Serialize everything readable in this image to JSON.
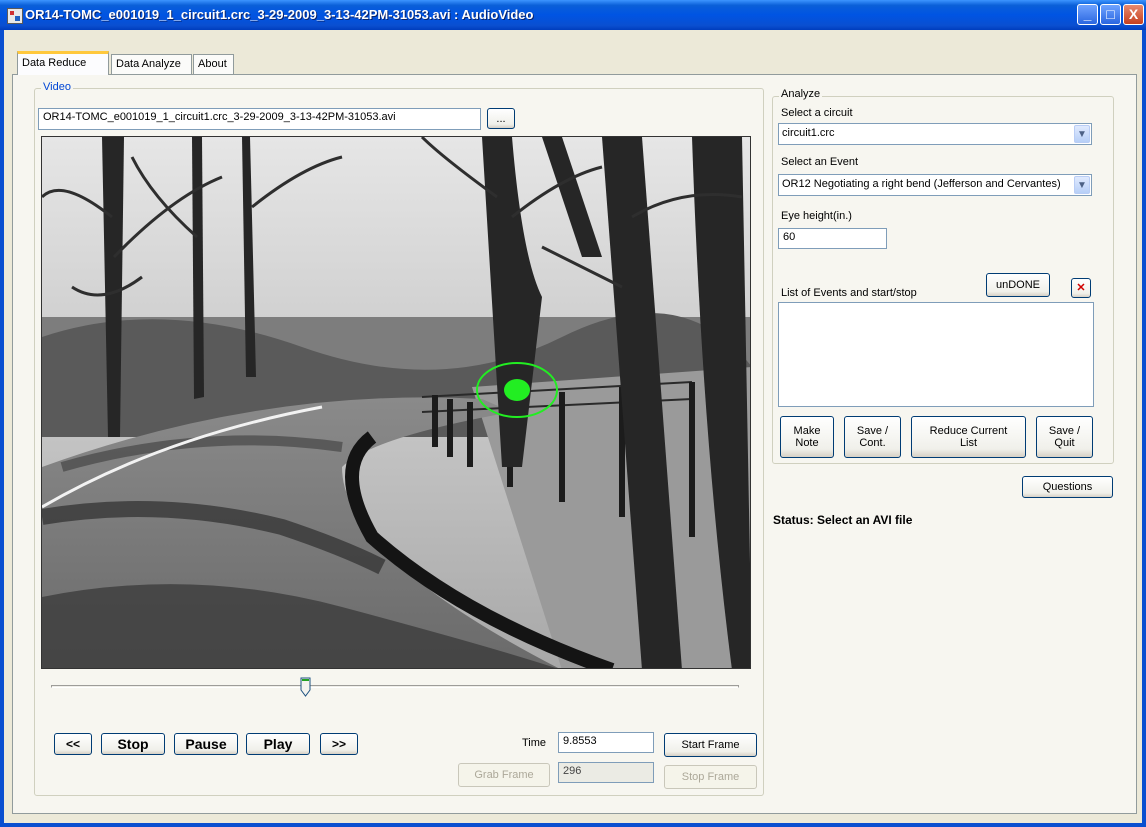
{
  "window": {
    "title": "OR14-TOMC_e001019_1_circuit1.crc_3-29-2009_3-13-42PM-31053.avi : AudioVideo",
    "minimize_glyph": "_",
    "maximize_glyph": "□",
    "close_glyph": "X"
  },
  "tabs": [
    {
      "label": "Data Reduce"
    },
    {
      "label": "Data Analyze"
    },
    {
      "label": "About"
    }
  ],
  "video_group": {
    "legend": "Video",
    "file_value": "OR14-TOMC_e001019_1_circuit1.crc_3-29-2009_3-13-42PM-31053.avi",
    "browse_label": "...",
    "slider_position": 0.37
  },
  "playback": {
    "rewind_label": "<<",
    "stop_label": "Stop",
    "pause_label": "Pause",
    "play_label": "Play",
    "forward_label": ">>"
  },
  "frames": {
    "time_label": "Time",
    "time_value": "9.8553",
    "start_frame_label": "Start Frame",
    "grab_frame_label": "Grab Frame",
    "frame_value": "296",
    "stop_frame_label": "Stop Frame"
  },
  "analyze": {
    "legend": "Analyze",
    "circuit_label": "Select a circuit",
    "circuit_value": "circuit1.crc",
    "event_label": "Select an Event",
    "event_value": "OR12 Negotiating a right bend (Jefferson and Cervantes)",
    "eye_height_label": "Eye height(in.)",
    "eye_height_value": "60",
    "list_label": "List of Events and start/stop",
    "undone_label": "unDONE",
    "delete_glyph": "✕",
    "make_note_label": "Make\nNote",
    "save_cont_label": "Save /\nCont.",
    "reduce_label": "Reduce Current\nList",
    "save_quit_label": "Save /\nQuit"
  },
  "questions_label": "Questions",
  "status_text": "Status: Select an AVI file",
  "colors": {
    "titlebar": "#0054e3",
    "tab_highlight": "#ffc83c",
    "gaze_marker": "#22ee22",
    "close_button": "#c6401f"
  }
}
